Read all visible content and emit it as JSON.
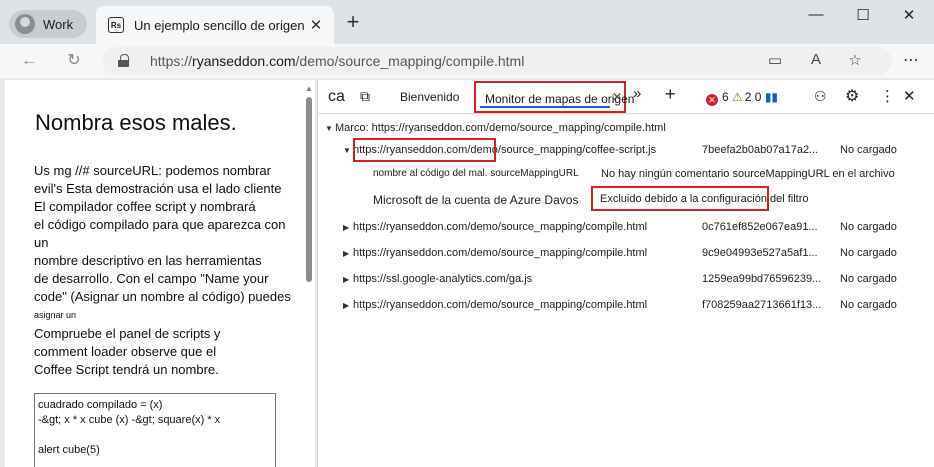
{
  "browser": {
    "profile_label": "Work",
    "tab": {
      "favicon": "Rs",
      "title": "Un ejemplo sencillo de origen",
      "close": "✕"
    },
    "new_tab": "+",
    "window_controls": {
      "minimize": "—",
      "maximize": "☐",
      "close": "✕"
    },
    "url": {
      "scheme": "https://",
      "host": "ryanseddon.com",
      "path": "/demo/source_mapping/compile.html"
    }
  },
  "page": {
    "heading": "Nombra esos males.",
    "para1_lines": [
      "Us mg //# sourceURL: podemos nombrar",
      "evil's Esta demostración usa el lado cliente",
      "El compilador coffee script y nombrará",
      "el código compilado para que aparezca con un",
      "nombre descriptivo en las herramientas",
      "de desarrollo. Con el campo \"Name your",
      "code\" (Asignar un nombre al código) puedes"
    ],
    "para1_small": "asignar un",
    "para2_lines": [
      "Compruebe el panel de scripts y",
      "comment loader observe que el",
      "Coffee Script tendrá un nombre."
    ],
    "code_lines": [
      "cuadrado compilado = (x)",
      "-&gt; x * x cube  (x) -&gt; square(x)       *   x",
      "",
      "alert cube(5)"
    ]
  },
  "devtools": {
    "toolbar": {
      "console_short": "ca",
      "welcome_tab": "Bienvenido",
      "active_tab": "Monitor de mapas de origen",
      "more_tabs": "»",
      "add_tab": "+",
      "errors": "6",
      "warnings": "2 0",
      "settings_icon": "⚙",
      "more_icon": "⋮",
      "close_icon": "✕"
    },
    "frame_label": "Marco: https://ryanseddon.com/demo/source_mapping/compile.html",
    "rows": [
      {
        "url": "https://ryanseddon.com/demo/source_mapping/coffee-script.js",
        "hash": "7beefa2b0ab07a17a2...",
        "status": "No cargado",
        "expanded": true
      },
      {
        "url": "https://ryanseddon.com/demo/source_mapping/compile.html",
        "hash": "0c761ef852e067ea91...",
        "status": "No cargado",
        "expanded": false
      },
      {
        "url": "https://ryanseddon.com/demo/source_mapping/compile.html",
        "hash": "9c9e04993e527a5af1...",
        "status": "No cargado",
        "expanded": false
      },
      {
        "url": "https://ssl.google-analytics.com/ga.js",
        "hash": "1259ea99bd76596239...",
        "status": "No cargado",
        "expanded": false
      },
      {
        "url": "https://ryanseddon.com/demo/source_mapping/compile.html",
        "hash": "f708259aa2713661f13...",
        "status": "No cargado",
        "expanded": false
      }
    ],
    "child1": {
      "label": "nombre al código del mal. sourceMappingURL",
      "value": "No hay ningún comentario sourceMappingURL en el archivo"
    },
    "child2": {
      "label": "Microsoft de la cuenta de Azure Davos",
      "value": "Excluido debido a la configuración del filtro"
    }
  }
}
